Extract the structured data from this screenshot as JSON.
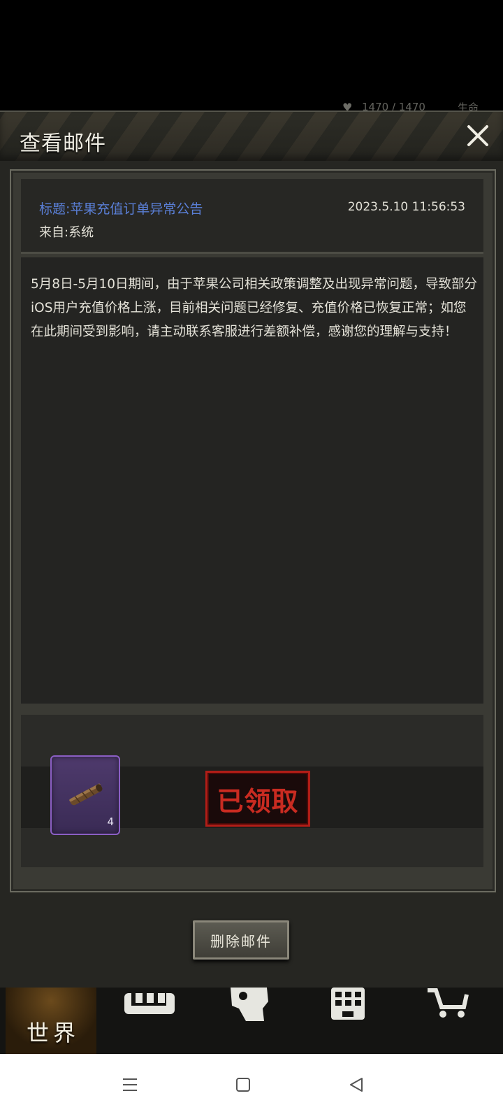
{
  "status_peek": {
    "stat_value": "1470 / 1470",
    "stat_label": "生命"
  },
  "dialog": {
    "title": "查看邮件",
    "close_icon": "close-icon"
  },
  "mail": {
    "subject": "标题:苹果充值订单异常公告",
    "datetime": "2023.5.10 11:56:53",
    "from": "来自:系统",
    "body": "5月8日-5月10日期间，由于苹果公司相关政策调整及出现异常问题，导致部分iOS用户充值价格上涨，目前相关问题已经修复、充值价格已恢复正常；如您在此期间受到影响，请主动联系客服进行差额补偿，感谢您的理解与支持！"
  },
  "attachment": {
    "item_icon": "cigar-icon",
    "count": "4",
    "status_stamp": "已领取"
  },
  "actions": {
    "delete_label": "删除邮件"
  },
  "bottom_nav": {
    "world_label": "世界",
    "icons": [
      "shop-icon",
      "head-icon",
      "building-icon",
      "cart-icon"
    ]
  },
  "system_nav": {
    "icons": [
      "menu-icon",
      "home-icon",
      "back-icon"
    ]
  },
  "colors": {
    "subject": "#5a7fd6",
    "stamp_red": "#c92b21",
    "rarity_purple": "#8b5fc4"
  }
}
